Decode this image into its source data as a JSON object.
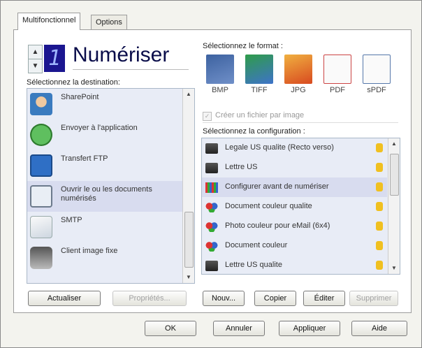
{
  "tabs": [
    "Multifonctionnel",
    "Options"
  ],
  "header": {
    "counter": "1",
    "title": "Numériser"
  },
  "destination": {
    "label": "Sélectionnez la destination:",
    "items": [
      {
        "label": "SharePoint",
        "icon": "sharepoint-icon"
      },
      {
        "label": "Envoyer à l'application",
        "icon": "send-to-app-icon"
      },
      {
        "label": "Transfert FTP",
        "icon": "ftp-icon"
      },
      {
        "label": "Ouvrir le ou les documents numérisés",
        "icon": "open-documents-icon",
        "selected": true
      },
      {
        "label": "SMTP",
        "icon": "smtp-icon"
      },
      {
        "label": "Client image fixe",
        "icon": "still-image-client-icon"
      }
    ]
  },
  "format": {
    "label": "Sélectionnez le format :",
    "items": [
      {
        "label": "BMP",
        "icon": "bmp-icon",
        "selected": true
      },
      {
        "label": "TIFF",
        "icon": "tiff-icon"
      },
      {
        "label": "JPG",
        "icon": "jpg-icon"
      },
      {
        "label": "PDF",
        "icon": "pdf-icon"
      },
      {
        "label": "sPDF",
        "icon": "spdf-icon"
      }
    ],
    "checkbox_label": "Créer un fichier par image"
  },
  "configuration": {
    "label": "Sélectionnez la configuration :",
    "items": [
      {
        "label": "Legale US qualite (Recto verso)",
        "icon": "scanner-config-icon"
      },
      {
        "label": "Lettre US",
        "icon": "scanner-config-icon"
      },
      {
        "label": "Configurer avant de numériser",
        "icon": "configure-before-scan-icon",
        "selected": true
      },
      {
        "label": "Document couleur qualite",
        "icon": "color-document-icon"
      },
      {
        "label": "Photo couleur pour eMail (6x4)",
        "icon": "color-document-icon"
      },
      {
        "label": "Document couleur",
        "icon": "color-document-icon"
      },
      {
        "label": "Lettre US qualite",
        "icon": "scanner-config-icon"
      }
    ]
  },
  "buttons": {
    "refresh": "Actualiser",
    "properties": "Propriétés...",
    "new": "Nouv...",
    "copy": "Copier",
    "edit": "Éditer",
    "delete": "Supprimer",
    "ok": "OK",
    "cancel": "Annuler",
    "apply": "Appliquer",
    "help": "Aide"
  },
  "colors": {
    "lcd_bg": "#1b1690",
    "selection": "#d8dcef",
    "list_bg": "#e8ecf6"
  }
}
